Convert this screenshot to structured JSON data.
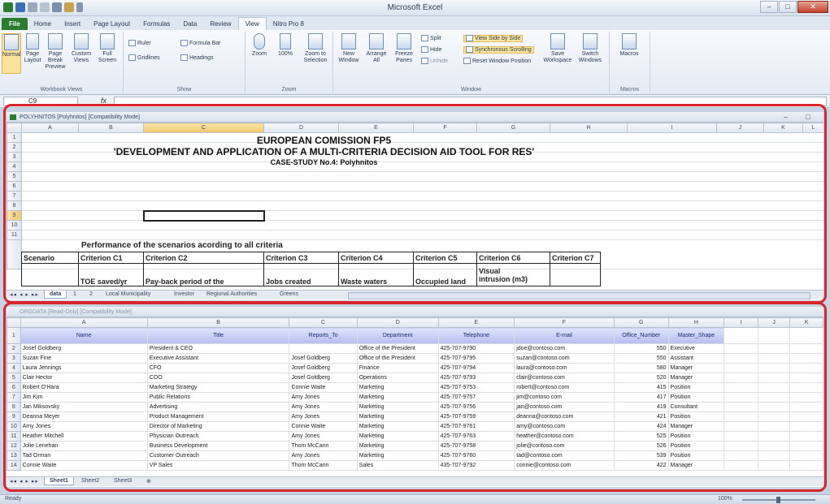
{
  "app": {
    "title": "Microsoft Excel",
    "window_controls": [
      "–",
      "□",
      "✕"
    ]
  },
  "ribbon": {
    "tabs": [
      "File",
      "Home",
      "Insert",
      "Page Layout",
      "Formulas",
      "Data",
      "Review",
      "View",
      "Nitro Pro 8"
    ],
    "active_tab": "View",
    "groups": {
      "workbook_views": {
        "label": "Workbook Views",
        "normal": "Normal",
        "page_layout": "Page Layout",
        "page_break": "Page Break Preview",
        "custom_views": "Custom Views",
        "full_screen": "Full Screen"
      },
      "show": {
        "label": "Show",
        "ruler": "Ruler",
        "formula_bar": "Formula Bar",
        "gridlines": "Gridlines",
        "headings": "Headings"
      },
      "zoom": {
        "label": "Zoom",
        "zoom": "Zoom",
        "zoom100": "100%",
        "zoom_selection": "Zoom to Selection"
      },
      "window": {
        "label": "Window",
        "new_window": "New Window",
        "arrange_all": "Arrange All",
        "freeze_panes": "Freeze Panes",
        "split": "Split",
        "hide": "Hide",
        "unhide": "Unhide",
        "view_side": "View Side by Side",
        "sync_scroll": "Synchronous Scrolling",
        "reset_pos": "Reset Window Position",
        "save_workspace": "Save Workspace",
        "switch_windows": "Switch Windows"
      },
      "macros": {
        "label": "Macros",
        "macros": "Macros"
      }
    }
  },
  "formula_bar": {
    "cell": "C9",
    "fx": "fx",
    "value": ""
  },
  "top_window": {
    "title": "POLYHNITOS [Polyhnitos] [Compatibility Mode]",
    "columns": [
      "",
      "A",
      "B",
      "C",
      "D",
      "E",
      "F",
      "G",
      "H",
      "I",
      "J",
      "K",
      "L"
    ],
    "rows": [
      "1",
      "2",
      "3",
      "4",
      "5",
      "6",
      "7",
      "8",
      "9",
      "10",
      "11"
    ],
    "heading1": "EUROPEAN COMISSION FP5",
    "heading2": "'DEVELOPMENT AND APPLICATION OF A MULTI-CRITERIA DECISION AID TOOL FOR RES'",
    "heading3": "CASE-STUDY No.4: Polyhnitos",
    "performance": "Performance of the scenarios acording to all criteria",
    "criteria_headers": [
      "Scenario",
      "Criterion C1",
      "Criterion C2",
      "Criterion C3",
      "Criterion C4",
      "Criterion C5",
      "Criterion C6",
      "Criterion C7"
    ],
    "visual_label": "Visual",
    "row12": [
      "",
      "TOE saved/yr",
      "Pay-back period of the",
      "Jobs created",
      "Waste waters",
      "Occupied land",
      "intrusion (m3)"
    ],
    "sheet_tabs": [
      "data",
      "1",
      "2",
      "Local Municipality",
      "Investor",
      "Regional Authorities",
      "Greens"
    ]
  },
  "bottom_window": {
    "title": "ORGDATA [Read-Only] [Compatibility Mode]",
    "columns": [
      "",
      "A",
      "B",
      "C",
      "D",
      "E",
      "F",
      "G",
      "H",
      "I",
      "J",
      "K"
    ],
    "headers": [
      "Name",
      "Title",
      "Reports_To",
      "Department",
      "Telephone",
      "E-mail",
      "Office_Number",
      "Master_Shape"
    ],
    "rows": [
      [
        "2",
        "Josef Goldberg",
        "President & CEO",
        "",
        "Office of the President",
        "425-707-9790",
        "jdoe@contoso.com",
        "550",
        "Executive"
      ],
      [
        "3",
        "Suzan Fine",
        "Executive Assistant",
        "Josef Goldberg",
        "Office of the President",
        "425-707-9795",
        "suzan@contoso.com",
        "550",
        "Assistant"
      ],
      [
        "4",
        "Laura Jennings",
        "CFO",
        "Josef Goldberg",
        "Finance",
        "425-707-9794",
        "laura@contoso.com",
        "580",
        "Manager"
      ],
      [
        "5",
        "Clair Hector",
        "COO",
        "Josef Goldberg",
        "Operations",
        "425-707-9793",
        "clair@contoso.com",
        "520",
        "Manager"
      ],
      [
        "6",
        "Robert O'Hara",
        "Marketing Strategy",
        "Connie Waite",
        "Marketing",
        "425-707-9753",
        "robert@contoso.com",
        "415",
        "Position"
      ],
      [
        "7",
        "Jim Kim",
        "Public Relations",
        "Amy Jones",
        "Marketing",
        "425-707-9757",
        "jim@contoso.com",
        "417",
        "Position"
      ],
      [
        "8",
        "Jan Miksovsky",
        "Advertising",
        "Amy Jones",
        "Marketing",
        "425-707-9756",
        "jan@contoso.com",
        "419",
        "Consultant"
      ],
      [
        "9",
        "Deanna Meyer",
        "Product Management",
        "Amy Jones",
        "Marketing",
        "425-707-9759",
        "deanna@contoso.com",
        "421",
        "Position"
      ],
      [
        "10",
        "Amy Jones",
        "Director of Marketing",
        "Connie Waite",
        "Marketing",
        "425-707-9761",
        "amy@contoso.com",
        "424",
        "Manager"
      ],
      [
        "11",
        "Heather Mitchell",
        "Physician Outreach",
        "Amy Jones",
        "Marketing",
        "425-707-9763",
        "heather@contoso.com",
        "525",
        "Position"
      ],
      [
        "12",
        "Jolie Lenehan",
        "Business Development",
        "Thom McCann",
        "Marketing",
        "425-707-9758",
        "jolie@contoso.com",
        "526",
        "Position"
      ],
      [
        "13",
        "Tad Orman",
        "Customer Outreach",
        "Amy Jones",
        "Marketing",
        "425-707-9760",
        "tad@contoso.com",
        "539",
        "Position"
      ],
      [
        "14",
        "Connie Waite",
        "VP Sales",
        "Thom McCann",
        "Sales",
        "435-707-9792",
        "connie@contoso.com",
        "422",
        "Manager"
      ]
    ],
    "sheet_tabs": [
      "Sheet1",
      "Sheet2",
      "Sheet3"
    ]
  },
  "status": {
    "left": "Ready",
    "zoom": "100%"
  }
}
